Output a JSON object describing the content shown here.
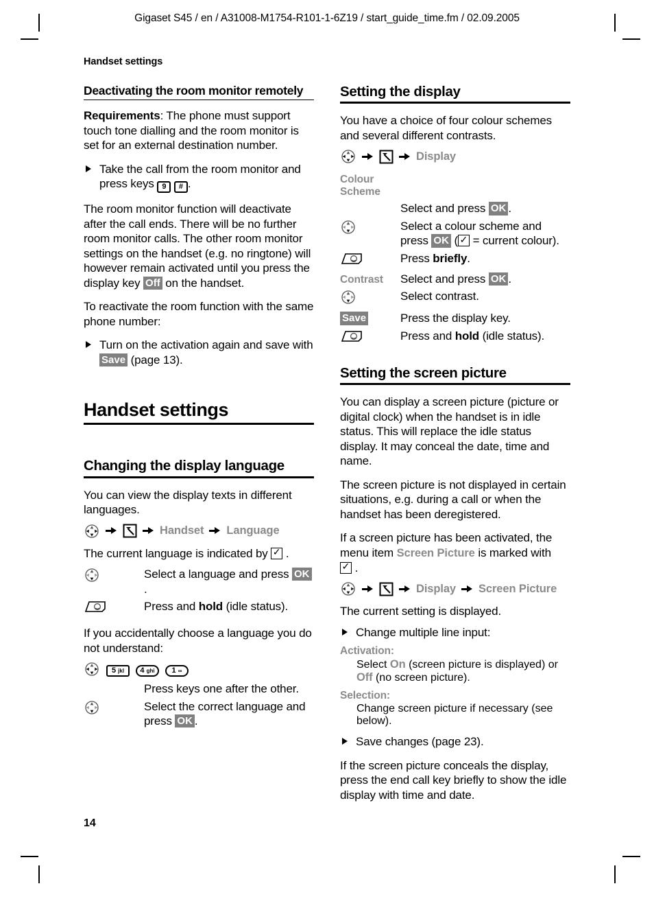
{
  "header": {
    "running_head": "Gigaset S45 / en / A31008-M1754-R101-1-6Z19 / start_guide_time.fm / 02.09.2005",
    "chapter_marker": "Handset settings"
  },
  "page_number": "14",
  "left_column": {
    "sub_heading": "Deactivating the room monitor remotely",
    "requirements_label": "Requirements",
    "requirements_text": ": The phone must support touch tone dialling and the room monitor is set for an external destination number.",
    "bullet_take_call_a": "Take the call from the room monitor and press keys ",
    "bullet_take_call_b": ".",
    "key_9": "9",
    "key_hash": "#",
    "para_deactivate_a": "The room monitor function will deactivate after the call ends. There will be no further room monitor calls. The other room monitor settings on the handset (e.g. no ringtone) will however remain activated until you press the display key ",
    "softkey_off": "Off",
    "para_deactivate_b": " on the handset.",
    "para_reactivate": "To reactivate the room function with the same phone number:",
    "bullet_turn_on_a": "Turn on the activation again and save with ",
    "softkey_save": "Save",
    "bullet_turn_on_b": " (page 13).",
    "chapter_title": "Handset settings",
    "section_language_title": "Changing the display language",
    "para_view_texts": "You can view the display texts in different languages.",
    "menu_path": {
      "nav_icon": "nav-key-icon",
      "menu_icon": "main-menu-icon",
      "item1": "Handset",
      "item2": "Language"
    },
    "para_current_language_a": "The current language is indicated by ",
    "para_current_language_b": ".",
    "step_select_language_a": "Select a language and press ",
    "step_select_language_ok": "OK",
    "step_select_language_b": ".",
    "step_press_hold_a": "Press and ",
    "step_press_hold_bold": "hold",
    "step_press_hold_b": " (idle status).",
    "para_accidental": "If you accidentally choose a language you do not understand:",
    "keys_row": [
      {
        "digit": "5",
        "letters": "jkl"
      },
      {
        "digit": "4",
        "letters": "ghi"
      },
      {
        "digit": "1",
        "letters": "∞"
      }
    ],
    "step_press_keys": "Press keys one after the other.",
    "step_select_correct_a": "Select the correct language and press ",
    "step_select_correct_ok": "OK",
    "step_select_correct_b": "."
  },
  "right_column": {
    "section_display_title": "Setting the display",
    "para_colour_schemes": "You have a choice of four colour schemes and several different contrasts.",
    "menu_path_display": {
      "item1": "Display"
    },
    "label_colour_scheme": "Colour Scheme",
    "step_select_press_a": "Select and press ",
    "step_select_press_ok": "OK",
    "step_select_press_b": ".",
    "step_colour_scheme_a": "Select a colour scheme and press ",
    "step_colour_scheme_ok": "OK",
    "step_colour_scheme_b": " (",
    "step_colour_scheme_c": " = current colour).",
    "step_press_briefly_a": "Press ",
    "step_press_briefly_bold": "briefly",
    "step_press_briefly_b": ".",
    "label_contrast": "Contrast",
    "step_contrast_select_a": "Select and press ",
    "step_contrast_select_ok": "OK",
    "step_contrast_select_b": ".",
    "step_select_contrast": "Select contrast.",
    "softkey_save": "Save",
    "step_press_display_key": "Press the display key.",
    "step_press_hold_a": "Press and ",
    "step_press_hold_bold": "hold",
    "step_press_hold_b": " (idle status).",
    "section_screen_picture_title": "Setting the screen picture",
    "para_screen_picture_1": "You can display a screen picture (picture or digital clock) when the handset is in idle status. This will replace the idle status display. It may conceal the date, time and name.",
    "para_screen_picture_2": "The screen picture is not displayed in certain situations, e.g. during a call or when the handset has been deregistered.",
    "para_screen_picture_3a": "If a screen picture has been activated, the menu item ",
    "menuitem_screen_picture": "Screen Picture",
    "para_screen_picture_3b": " is marked with ",
    "para_screen_picture_3c": ".",
    "menu_path_screen_picture": {
      "item1": "Display",
      "item2": "Screen Picture"
    },
    "para_current_setting": "The current setting is displayed.",
    "bullet_change_multiple": "Change multiple line input:",
    "label_activation": "Activation:",
    "activation_text_a": "Select ",
    "activation_on": "On",
    "activation_text_b": " (screen picture is displayed) or ",
    "activation_off": "Off",
    "activation_text_c": " (no screen picture).",
    "label_selection": "Selection:",
    "selection_text": "Change screen picture if necessary (see below).",
    "bullet_save_changes": "Save changes (page 23).",
    "para_conceals": "If the screen picture conceals the display, press the end call key briefly to show the idle display with time and date."
  },
  "colors": {
    "softkey_background": "#808080",
    "menu_item_grey": "#8a8a8a",
    "text": "#000000",
    "background": "#ffffff"
  }
}
